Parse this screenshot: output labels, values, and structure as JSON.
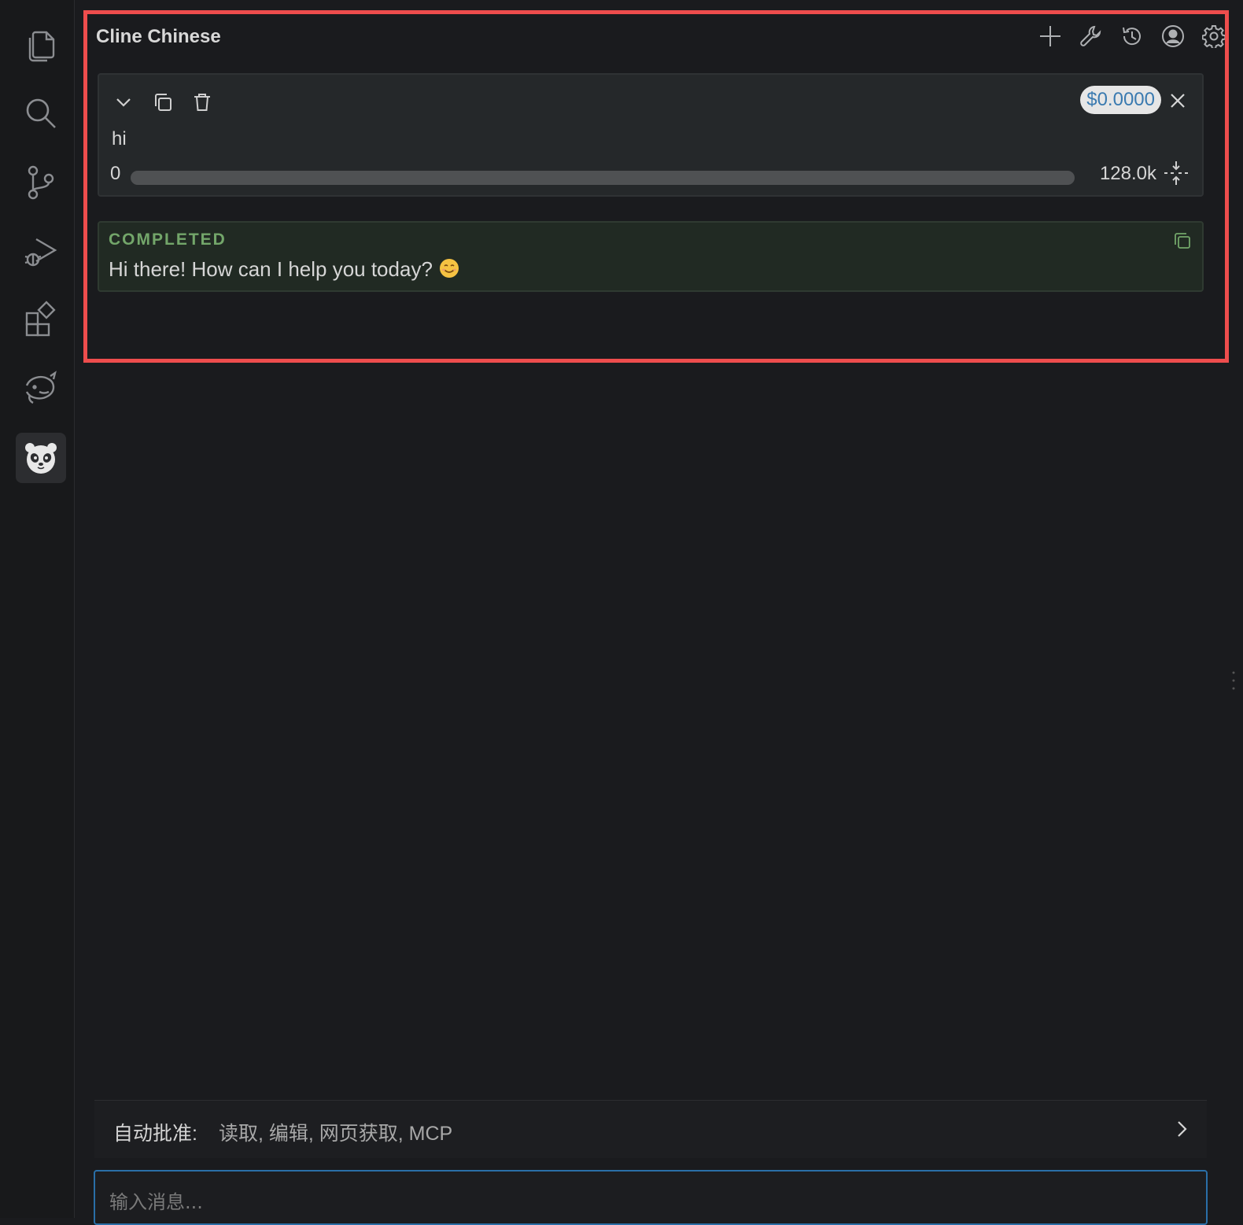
{
  "activity_bar": {
    "items": [
      {
        "name": "explorer",
        "icon": "files-icon"
      },
      {
        "name": "search",
        "icon": "search-icon"
      },
      {
        "name": "source-control",
        "icon": "source-control-icon"
      },
      {
        "name": "run-debug",
        "icon": "run-debug-icon"
      },
      {
        "name": "extensions",
        "icon": "extensions-icon"
      },
      {
        "name": "dolphin",
        "icon": "dolphin-icon"
      },
      {
        "name": "cline-chinese",
        "icon": "panda-icon",
        "active": true
      }
    ]
  },
  "header": {
    "title": "Cline Chinese",
    "icons": [
      "plus-icon",
      "wrench-icon",
      "history-icon",
      "account-icon",
      "gear-icon"
    ]
  },
  "task": {
    "text": "hi",
    "cost": "$0.0000",
    "context": {
      "min": "0",
      "max": "128.0k",
      "used_fraction": 0.0
    }
  },
  "result": {
    "status": "COMPLETED",
    "text": "Hi there! How can I help you today?"
  },
  "auto_approve": {
    "label": "自动批准:",
    "value": "读取, 编辑, 网页获取, MCP"
  },
  "input": {
    "placeholder": "输入消息...",
    "value": ""
  },
  "colors": {
    "accent": "#2a6fa8",
    "highlight": "#ee4d4d",
    "success": "#73a66a",
    "cost_text": "#3a7ab0"
  }
}
